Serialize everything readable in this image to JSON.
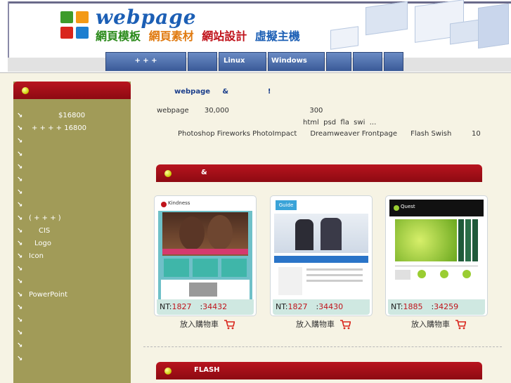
{
  "header": {
    "logo_text": "webpage",
    "tagline": [
      "網頁模板",
      "網頁素材",
      "網站設計",
      "虛擬主機"
    ],
    "tagline_colors": [
      "#2a8a1a",
      "#e07a10",
      "#c0131b",
      "#1c5fb5"
    ]
  },
  "nav": {
    "tabs": [
      {
        "label": "+ + +"
      },
      {
        "label": ""
      },
      {
        "label": "Linux"
      },
      {
        "label": "Windows"
      },
      {
        "label": ""
      },
      {
        "label": ""
      },
      {
        "label": ""
      }
    ]
  },
  "sidebar": {
    "items": [
      {
        "text": "$16800"
      },
      {
        "text": "+ + + +  16800"
      },
      {
        "text": ""
      },
      {
        "text": ""
      },
      {
        "text": ""
      },
      {
        "text": ""
      },
      {
        "text": ""
      },
      {
        "text": ""
      },
      {
        "text": "(  + +  +   )"
      },
      {
        "text": "CIS"
      },
      {
        "text": "Logo"
      },
      {
        "text": "Icon"
      },
      {
        "text": ""
      },
      {
        "text": ""
      },
      {
        "text": "PowerPoint"
      },
      {
        "text": ""
      },
      {
        "text": ""
      },
      {
        "text": ""
      },
      {
        "text": ""
      },
      {
        "text": ""
      }
    ]
  },
  "intro": {
    "title": "webpage     &                !",
    "line1": "webpage       30,000                                    300",
    "line2": "html  psd  fla  swi  ...",
    "line3": "Photoshop Fireworks PhotoImpact      Dreamweaver Frontpage      Flash Swish         10"
  },
  "section1": {
    "title": "&"
  },
  "section2": {
    "title": "FLASH"
  },
  "products": [
    {
      "price_label": "NT:",
      "price": "1827",
      "id_label": ":",
      "id": "34432",
      "cart": "放入購物車",
      "thumb_title": "Kindness"
    },
    {
      "price_label": "NT:",
      "price": "1827",
      "id_label": ":",
      "id": "34430",
      "cart": "放入購物車",
      "thumb_title": "Guide"
    },
    {
      "price_label": "NT:",
      "price": "1885",
      "id_label": ":",
      "id": "34259",
      "cart": "放入購物車",
      "thumb_title": "Quest"
    }
  ],
  "colors": {
    "accent_red": "#c0131b",
    "sidebar_olive": "#a19b58",
    "nav_blue": "#4a6aa8",
    "price_bg": "#cfe8e1"
  },
  "icons": [
    "cart-icon",
    "arrow-icon",
    "bullet-icon"
  ]
}
